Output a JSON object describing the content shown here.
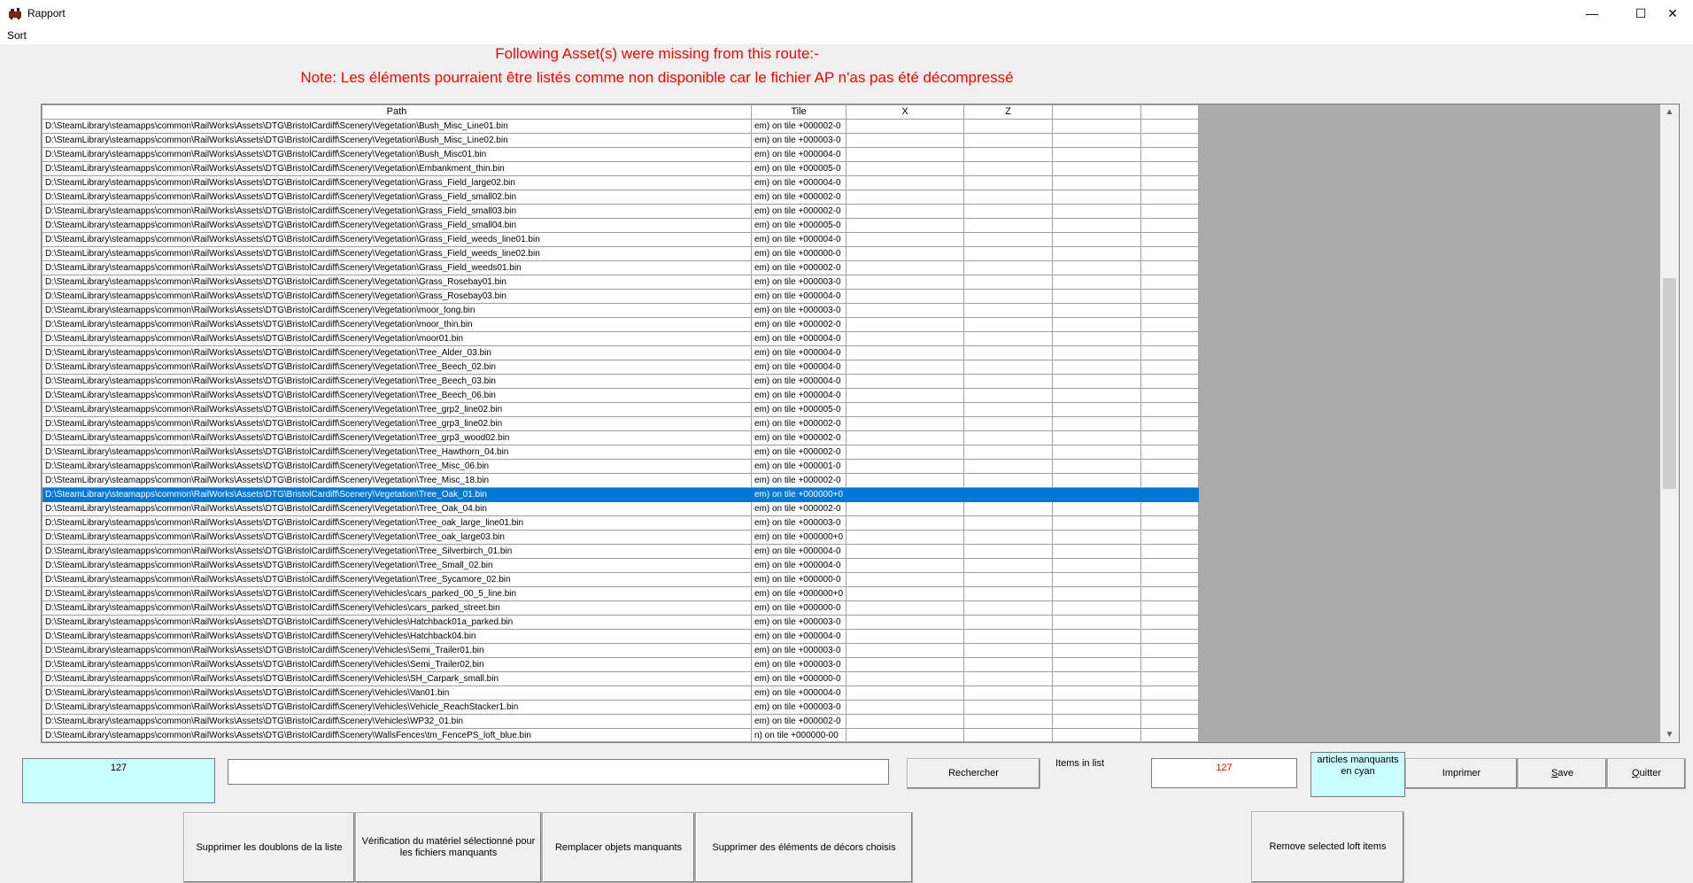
{
  "window": {
    "title": "Rapport",
    "minimize_glyph": "—",
    "maximize_glyph": "☐",
    "close_glyph": "✕"
  },
  "menu": {
    "sort_label": "Sort"
  },
  "headings": {
    "line1": "Following Asset(s) were missing from this route:-",
    "line2": "Note: Les éléments pourraient être listés comme non disponible car le fichier AP n'as pas été décompressé"
  },
  "table": {
    "columns": [
      "Path",
      "Tile",
      "X",
      "Z",
      "",
      ""
    ],
    "path_prefix": "D:\\SteamLibrary\\steamapps\\common\\RailWorks\\Assets\\DTG\\BristolCardiff\\Scenery\\",
    "selected_index": 26,
    "rows": [
      {
        "path": "Vegetation\\Bush_Misc_Line01.bin",
        "tile": "em) on tile +000002-0"
      },
      {
        "path": "Vegetation\\Bush_Misc_Line02.bin",
        "tile": "em) on tile +000003-0"
      },
      {
        "path": "Vegetation\\Bush_Misc01.bin",
        "tile": "em) on tile +000004-0"
      },
      {
        "path": "Vegetation\\Embankment_thin.bin",
        "tile": "em) on tile +000005-0"
      },
      {
        "path": "Vegetation\\Grass_Field_large02.bin",
        "tile": "em) on tile +000004-0"
      },
      {
        "path": "Vegetation\\Grass_Field_small02.bin",
        "tile": "em) on tile +000002-0"
      },
      {
        "path": "Vegetation\\Grass_Field_small03.bin",
        "tile": "em) on tile +000002-0"
      },
      {
        "path": "Vegetation\\Grass_Field_small04.bin",
        "tile": "em) on tile +000005-0"
      },
      {
        "path": "Vegetation\\Grass_Field_weeds_line01.bin",
        "tile": "em) on tile +000004-0"
      },
      {
        "path": "Vegetation\\Grass_Field_weeds_line02.bin",
        "tile": "em) on tile +000000-0"
      },
      {
        "path": "Vegetation\\Grass_Field_weeds01.bin",
        "tile": "em) on tile +000002-0"
      },
      {
        "path": "Vegetation\\Grass_Rosebay01.bin",
        "tile": "em) on tile +000003-0"
      },
      {
        "path": "Vegetation\\Grass_Rosebay03.bin",
        "tile": "em) on tile +000004-0"
      },
      {
        "path": "Vegetation\\moor_long.bin",
        "tile": "em) on tile +000003-0"
      },
      {
        "path": "Vegetation\\moor_thin.bin",
        "tile": "em) on tile +000002-0"
      },
      {
        "path": "Vegetation\\moor01.bin",
        "tile": "em) on tile +000004-0"
      },
      {
        "path": "Vegetation\\Tree_Alder_03.bin",
        "tile": "em) on tile +000004-0"
      },
      {
        "path": "Vegetation\\Tree_Beech_02.bin",
        "tile": "em) on tile +000004-0"
      },
      {
        "path": "Vegetation\\Tree_Beech_03.bin",
        "tile": "em) on tile +000004-0"
      },
      {
        "path": "Vegetation\\Tree_Beech_06.bin",
        "tile": "em) on tile +000004-0"
      },
      {
        "path": "Vegetation\\Tree_grp2_line02.bin",
        "tile": "em) on tile +000005-0"
      },
      {
        "path": "Vegetation\\Tree_grp3_line02.bin",
        "tile": "em) on tile +000002-0"
      },
      {
        "path": "Vegetation\\Tree_grp3_wood02.bin",
        "tile": "em) on tile +000002-0"
      },
      {
        "path": "Vegetation\\Tree_Hawthorn_04.bin",
        "tile": "em) on tile +000002-0"
      },
      {
        "path": "Vegetation\\Tree_Misc_06.bin",
        "tile": "em) on tile +000001-0"
      },
      {
        "path": "Vegetation\\Tree_Misc_18.bin",
        "tile": "em) on tile +000002-0"
      },
      {
        "path": "Vegetation\\Tree_Oak_01.bin",
        "tile": "em) on tile +000000+0"
      },
      {
        "path": "Vegetation\\Tree_Oak_04.bin",
        "tile": "em) on tile +000002-0"
      },
      {
        "path": "Vegetation\\Tree_oak_large_line01.bin",
        "tile": "em) on tile +000003-0"
      },
      {
        "path": "Vegetation\\Tree_oak_large03.bin",
        "tile": "em) on tile +000000+0"
      },
      {
        "path": "Vegetation\\Tree_Silverbirch_01.bin",
        "tile": "em) on tile +000004-0"
      },
      {
        "path": "Vegetation\\Tree_Small_02.bin",
        "tile": "em) on tile +000004-0"
      },
      {
        "path": "Vegetation\\Tree_Sycamore_02.bin",
        "tile": "em) on tile +000000-0"
      },
      {
        "path": "Vehicles\\cars_parked_00_5_line.bin",
        "tile": "em) on tile +000000+0"
      },
      {
        "path": "Vehicles\\cars_parked_street.bin",
        "tile": "em) on tile +000000-0"
      },
      {
        "path": "Vehicles\\Hatchback01a_parked.bin",
        "tile": "em) on tile +000003-0"
      },
      {
        "path": "Vehicles\\Hatchback04.bin",
        "tile": "em) on tile +000004-0"
      },
      {
        "path": "Vehicles\\Semi_Trailer01.bin",
        "tile": "em) on tile +000003-0"
      },
      {
        "path": "Vehicles\\Semi_Trailer02.bin",
        "tile": "em) on tile +000003-0"
      },
      {
        "path": "Vehicles\\SH_Carpark_small.bin",
        "tile": "em) on tile +000000-0"
      },
      {
        "path": "Vehicles\\Van01.bin",
        "tile": "em) on tile +000004-0"
      },
      {
        "path": "Vehicles\\Vehicle_ReachStacker1.bin",
        "tile": "em) on tile +000003-0"
      },
      {
        "path": "Vehicles\\WP32_01.bin",
        "tile": "em) on tile +000002-0"
      },
      {
        "path": "WallsFences\\tm_FencePS_loft_blue.bin",
        "tile": "n) on tile +000000-00"
      }
    ]
  },
  "footer": {
    "count_left": "127",
    "search_value": "",
    "search_button": "Rechercher",
    "items_label": "Items in list",
    "items_count": "127",
    "cyan_legend": "articles manquants en cyan",
    "print_button": "Imprimer",
    "save_u": "S",
    "save_rest": "ave",
    "quit_u": "Q",
    "quit_rest": "uitter",
    "dedup_button": "Supprimer les doublons de la liste",
    "verify_button": "Vérification du matériel sélectionné pour les fichiers manquants",
    "replace_button": "Remplacer objets manquants",
    "remove_decor_button": "Supprimer des éléments de décors choisis",
    "remove_loft_button": "Remove selected loft items"
  },
  "colors": {
    "heading": "#ff0000",
    "selection": "#0078d7",
    "cyan_box": "#c9ffff",
    "grid_background": "#ababab"
  }
}
